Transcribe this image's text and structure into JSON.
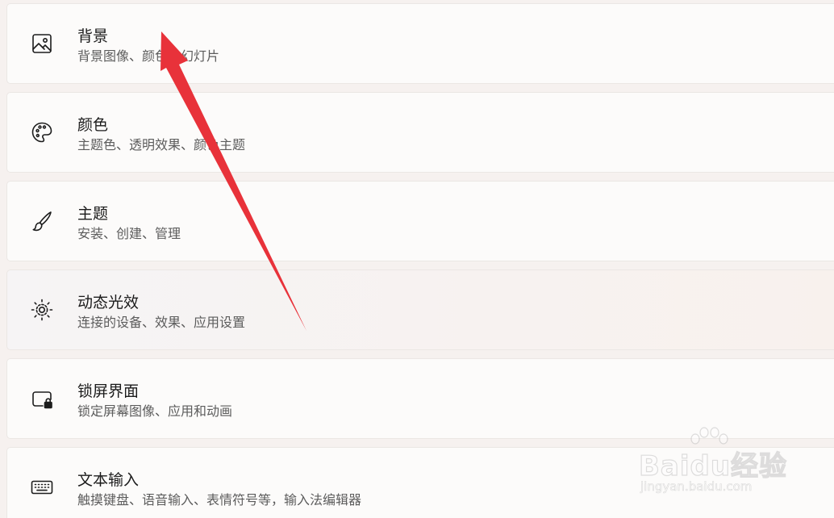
{
  "settings": {
    "items": [
      {
        "title": "背景",
        "subtitle": "背景图像、颜色、幻灯片",
        "icon": "picture-icon"
      },
      {
        "title": "颜色",
        "subtitle": "主题色、透明效果、颜色主题",
        "icon": "palette-icon"
      },
      {
        "title": "主题",
        "subtitle": "安装、创建、管理",
        "icon": "brush-icon"
      },
      {
        "title": "动态光效",
        "subtitle": "连接的设备、效果、应用设置",
        "icon": "dynamic-lighting-icon"
      },
      {
        "title": "锁屏界面",
        "subtitle": "锁定屏幕图像、应用和动画",
        "icon": "lock-screen-icon"
      },
      {
        "title": "文本输入",
        "subtitle": "触摸键盘、语音输入、表情符号等，输入法编辑器",
        "icon": "keyboard-icon"
      }
    ]
  },
  "annotation": {
    "arrow_color": "#e8323a"
  },
  "watermark": {
    "brand": "Baidu经验",
    "url": "jingyan.baidu.com"
  }
}
